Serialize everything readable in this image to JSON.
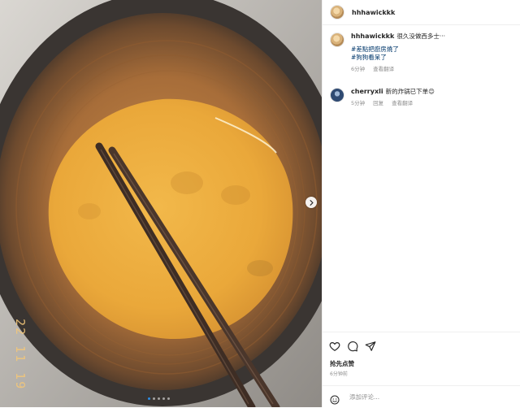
{
  "header": {
    "username": "hhhawickkk"
  },
  "comments": [
    {
      "username": "hhhawickkk",
      "text": "很久没做西多士···",
      "tags": [
        "#差點把廚房燒了",
        "#狗狗看呆了"
      ],
      "time": "6分钟",
      "translate": "查看翻译"
    },
    {
      "username": "cherryxli",
      "text": "新的炸锅已下单😊",
      "time": "5分钟",
      "reply": "回复",
      "translate": "查看翻译"
    }
  ],
  "actions": {
    "like_icon": "heart-icon",
    "comment_icon": "comment-icon",
    "share_icon": "paper-plane-icon"
  },
  "likes": "抢先点赞",
  "post_time": "6分钟前",
  "add_comment": {
    "placeholder": "添加评论..."
  },
  "media": {
    "carousel_dots": 5,
    "active_dot": 0,
    "overlay_text": "22 11 19"
  },
  "colors": {
    "link": "#00376b",
    "accent_dot": "#2b8de6",
    "muted": "#8e8e8e"
  }
}
